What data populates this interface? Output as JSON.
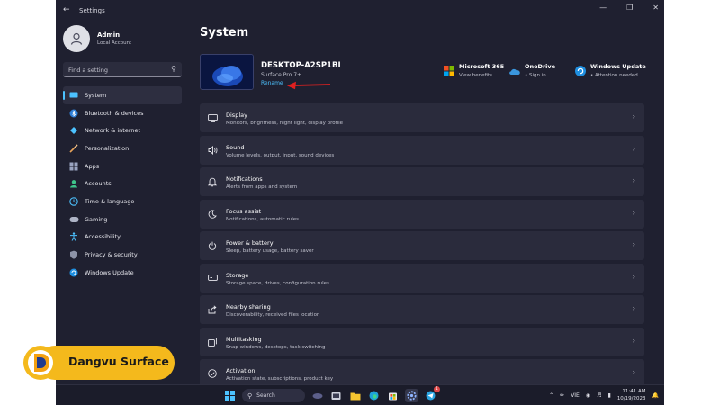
{
  "window": {
    "app_name": "Settings",
    "back_icon": "back-arrow-icon",
    "controls": [
      "minimize-icon",
      "maximize-icon",
      "close-icon"
    ]
  },
  "user": {
    "name": "Admin",
    "role": "Local Account"
  },
  "search": {
    "placeholder": "Find a setting"
  },
  "sidebar": {
    "items": [
      {
        "label": "System",
        "icon": "system-icon",
        "active": true
      },
      {
        "label": "Bluetooth & devices",
        "icon": "bluetooth-icon"
      },
      {
        "label": "Network & internet",
        "icon": "network-icon"
      },
      {
        "label": "Personalization",
        "icon": "brush-icon"
      },
      {
        "label": "Apps",
        "icon": "apps-icon"
      },
      {
        "label": "Accounts",
        "icon": "accounts-icon"
      },
      {
        "label": "Time & language",
        "icon": "globe-clock-icon"
      },
      {
        "label": "Gaming",
        "icon": "gamepad-icon"
      },
      {
        "label": "Accessibility",
        "icon": "accessibility-icon"
      },
      {
        "label": "Privacy & security",
        "icon": "shield-icon"
      },
      {
        "label": "Windows Update",
        "icon": "windows-update-icon"
      }
    ]
  },
  "main": {
    "title": "System",
    "device": {
      "name": "DESKTOP-A2SP1BI",
      "model": "Surface Pro 7+",
      "rename_label": "Rename"
    },
    "quick_links": [
      {
        "title": "Microsoft 365",
        "subtitle": "View benefits",
        "icon": "microsoft-365-icon"
      },
      {
        "title": "OneDrive",
        "subtitle": "• Sign in",
        "icon": "onedrive-icon"
      },
      {
        "title": "Windows Update",
        "subtitle": "• Attention needed",
        "icon": "windows-update-icon"
      }
    ],
    "cards": [
      {
        "title": "Display",
        "subtitle": "Monitors, brightness, night light, display profile",
        "icon": "display-icon"
      },
      {
        "title": "Sound",
        "subtitle": "Volume levels, output, input, sound devices",
        "icon": "speaker-icon"
      },
      {
        "title": "Notifications",
        "subtitle": "Alerts from apps and system",
        "icon": "bell-icon"
      },
      {
        "title": "Focus assist",
        "subtitle": "Notifications, automatic rules",
        "icon": "moon-icon"
      },
      {
        "title": "Power & battery",
        "subtitle": "Sleep, battery usage, battery saver",
        "icon": "power-icon"
      },
      {
        "title": "Storage",
        "subtitle": "Storage space, drives, configuration rules",
        "icon": "storage-icon"
      },
      {
        "title": "Nearby sharing",
        "subtitle": "Discoverability, received files location",
        "icon": "share-icon"
      },
      {
        "title": "Multitasking",
        "subtitle": "Snap windows, desktops, task switching",
        "icon": "multitasking-icon"
      },
      {
        "title": "Activation",
        "subtitle": "Activation state, subscriptions, product key",
        "icon": "activation-icon"
      }
    ]
  },
  "taskbar": {
    "search_label": "Search",
    "chat_badge": "1",
    "language": "VIE",
    "time": "11:41 AM",
    "date": "10/19/2023"
  },
  "watermark": {
    "text": "Dangvu Surface"
  },
  "colors": {
    "background": "#1f2030",
    "card": "#2a2b3c",
    "accent": "#4cc2ff",
    "arrow": "#e02020",
    "brand": "#f4b91c"
  }
}
